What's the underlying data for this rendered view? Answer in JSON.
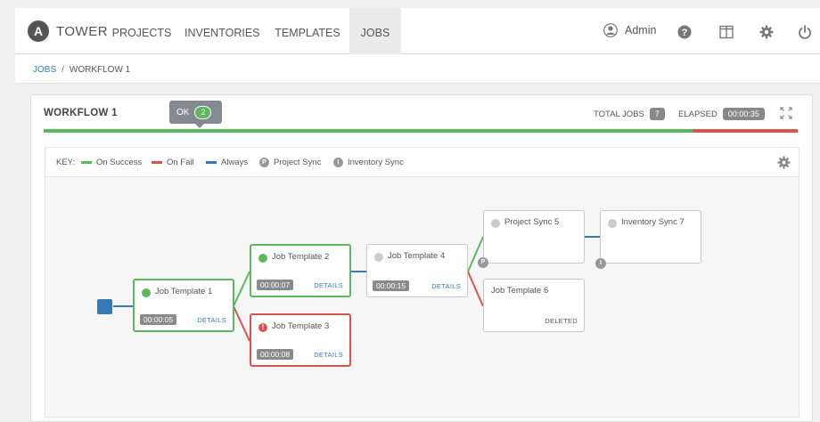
{
  "nav": {
    "logo_letter": "A",
    "brand": "TOWER",
    "items": [
      "PROJECTS",
      "INVENTORIES",
      "TEMPLATES",
      "JOBS"
    ],
    "active": "JOBS",
    "user": "Admin"
  },
  "breadcrumb": {
    "parent": "JOBS",
    "separator": "/",
    "current": "WORKFLOW 1"
  },
  "workflow": {
    "title": "WORKFLOW 1",
    "total_jobs_label": "TOTAL JOBS",
    "total_jobs": "7",
    "elapsed_label": "ELAPSED",
    "elapsed": "00:00:35",
    "progress_success_fraction": 0.86,
    "tooltip_label": "OK",
    "tooltip_count": "2"
  },
  "key": {
    "label": "KEY:",
    "on_success": "On Success",
    "on_fail": "On Fail",
    "always": "Always",
    "project_sync_letter": "P",
    "project_sync": "Project Sync",
    "inventory_sync_letter": "I",
    "inventory_sync": "Inventory Sync"
  },
  "nodes": {
    "jt1": {
      "name": "Job Template 1",
      "time": "00:00:05",
      "details": "DETAILS"
    },
    "jt2": {
      "name": "Job Template 2",
      "time": "00:00:07",
      "details": "DETAILS"
    },
    "jt3": {
      "name": "Job Template 3",
      "time": "00:00:08",
      "details": "DETAILS",
      "status_glyph": "!"
    },
    "jt4": {
      "name": "Job Template 4",
      "time": "00:00:15",
      "details": "DETAILS"
    },
    "ps5": {
      "name": "Project Sync 5",
      "badge": "P"
    },
    "jt6": {
      "name": "Job Template 6",
      "deleted": "DELETED"
    },
    "is7": {
      "name": "Inventory Sync 7",
      "badge": "I"
    }
  },
  "colors": {
    "success": "#5cb85c",
    "fail": "#d9534f",
    "always": "#337ab7",
    "link": "#337ab7"
  }
}
